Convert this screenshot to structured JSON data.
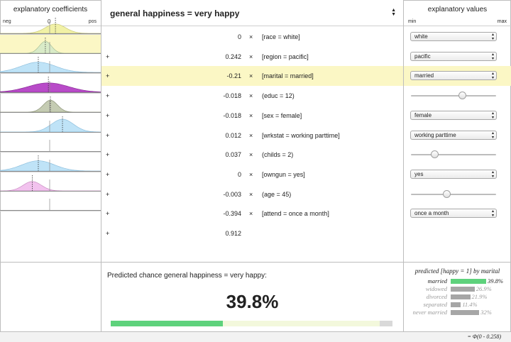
{
  "left_panel": {
    "title": "explanatory coefficients",
    "axis": {
      "neg": "neg",
      "zero": "0",
      "pos": "pos"
    }
  },
  "outcome": {
    "title": "general happiness = very happy"
  },
  "equation": {
    "rows": [
      {
        "plus": "",
        "coef": "0",
        "times": "×",
        "term": "[race = white]",
        "highlight": false
      },
      {
        "plus": "+",
        "coef": "0.242",
        "times": "×",
        "term": "[region = pacific]",
        "highlight": false
      },
      {
        "plus": "+",
        "coef": "-0.21",
        "times": "×",
        "term": "[marital = married]",
        "highlight": true
      },
      {
        "plus": "+",
        "coef": "-0.018",
        "times": "×",
        "term": "(educ = 12)",
        "highlight": false
      },
      {
        "plus": "+",
        "coef": "-0.018",
        "times": "×",
        "term": "[sex = female]",
        "highlight": false
      },
      {
        "plus": "+",
        "coef": "0.012",
        "times": "×",
        "term": "[wrkstat = working parttime]",
        "highlight": false
      },
      {
        "plus": "+",
        "coef": "0.037",
        "times": "×",
        "term": "(childs = 2)",
        "highlight": false
      },
      {
        "plus": "+",
        "coef": "0",
        "times": "×",
        "term": "[owngun = yes]",
        "highlight": false
      },
      {
        "plus": "+",
        "coef": "-0.003",
        "times": "×",
        "term": "(age = 45)",
        "highlight": false
      },
      {
        "plus": "+",
        "coef": "-0.394",
        "times": "×",
        "term": "[attend = once a month]",
        "highlight": false
      },
      {
        "plus": "+",
        "coef": "0.912",
        "times": "",
        "term": "",
        "highlight": false
      }
    ]
  },
  "right_panel": {
    "title": "explanatory values",
    "range": {
      "min": "min",
      "max": "max"
    },
    "controls": [
      {
        "type": "select",
        "value": "white"
      },
      {
        "type": "select",
        "value": "pacific"
      },
      {
        "type": "select",
        "value": "married"
      },
      {
        "type": "slider",
        "level": 0.6
      },
      {
        "type": "select",
        "value": "female"
      },
      {
        "type": "select",
        "value": "working parttime"
      },
      {
        "type": "slider",
        "level": 0.28
      },
      {
        "type": "select",
        "value": "yes"
      },
      {
        "type": "slider",
        "level": 0.42
      },
      {
        "type": "select",
        "value": "once a month"
      }
    ]
  },
  "distributions": [
    {
      "color": "#f1f1a6",
      "edge": "#c9c97a",
      "mean": 0.55,
      "spread": 0.1,
      "height": 0.55,
      "visible": true
    },
    {
      "color": "#d9ebc8",
      "edge": "#a9bf95",
      "mean": 0.45,
      "spread": 0.06,
      "height": 0.7,
      "visible": true
    },
    {
      "color": "#bfe3f7",
      "edge": "#8fc0de",
      "mean": 0.38,
      "spread": 0.17,
      "height": 0.6,
      "visible": true
    },
    {
      "color": "#b84bc8",
      "edge": "#8a2f98",
      "mean": 0.48,
      "spread": 0.2,
      "height": 0.55,
      "visible": true
    },
    {
      "color": "#c5ccb3",
      "edge": "#8d9478",
      "mean": 0.5,
      "spread": 0.07,
      "height": 0.7,
      "visible": true
    },
    {
      "color": "#bfe3f7",
      "edge": "#8fc0de",
      "mean": 0.62,
      "spread": 0.11,
      "height": 0.75,
      "visible": true
    },
    {
      "color": "#ffffff",
      "edge": "#ffffff",
      "mean": 0.5,
      "spread": 0.1,
      "height": 0,
      "visible": false
    },
    {
      "color": "#bfe3f7",
      "edge": "#8fc0de",
      "mean": 0.38,
      "spread": 0.16,
      "height": 0.6,
      "visible": true
    },
    {
      "color": "#f2c2ee",
      "edge": "#c98fc3",
      "mean": 0.32,
      "spread": 0.09,
      "height": 0.55,
      "visible": true
    },
    {
      "color": "#ffffff",
      "edge": "#ffffff",
      "mean": 0.5,
      "spread": 0.1,
      "height": 0,
      "visible": false
    }
  ],
  "prediction": {
    "label": "Predicted chance general happiness = very happy:",
    "value": "39.8%",
    "fraction": 0.398
  },
  "by_marital": {
    "title": "predicted [happy = 1] by marital",
    "rows": [
      {
        "label": "married",
        "pct": "39.8%",
        "value": 0.398,
        "color": "#5ed27c",
        "active": true
      },
      {
        "label": "widowed",
        "pct": "26.9%",
        "value": 0.269,
        "color": "#a6a6a6",
        "active": false
      },
      {
        "label": "divorced",
        "pct": "21.9%",
        "value": 0.219,
        "color": "#a6a6a6",
        "active": false
      },
      {
        "label": "separated",
        "pct": "11.4%",
        "value": 0.114,
        "color": "#a6a6a6",
        "active": false
      },
      {
        "label": "never married",
        "pct": "32%",
        "value": 0.32,
        "color": "#a6a6a6",
        "active": false
      }
    ]
  },
  "footer": {
    "formula": "= Φ(0 - 0.258)"
  }
}
